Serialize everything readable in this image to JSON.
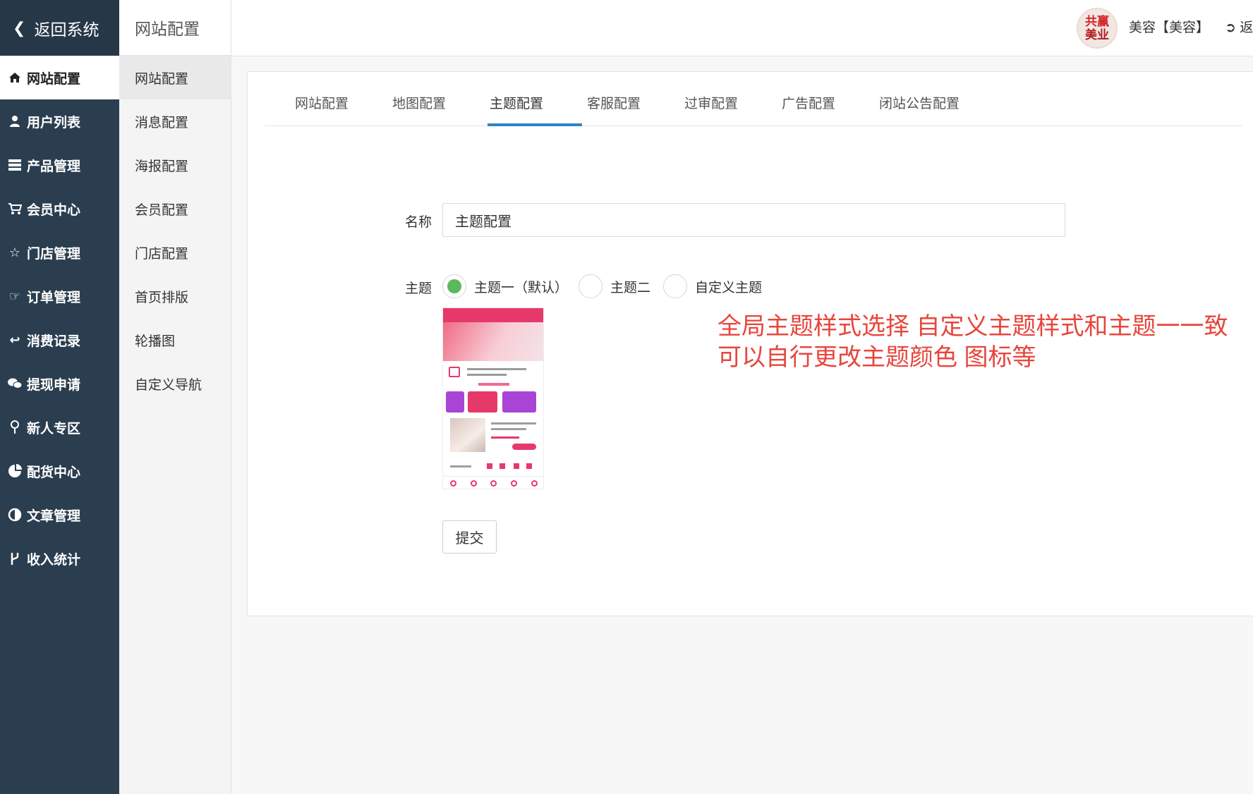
{
  "sidebar": {
    "back_label": "返回系统",
    "items": [
      {
        "label": "网站配置",
        "icon": "home-icon"
      },
      {
        "label": "用户列表",
        "icon": "user-icon"
      },
      {
        "label": "产品管理",
        "icon": "server-icon"
      },
      {
        "label": "会员中心",
        "icon": "cart-icon"
      },
      {
        "label": "门店管理",
        "icon": "star-icon"
      },
      {
        "label": "订单管理",
        "icon": "hand-right-icon"
      },
      {
        "label": "消费记录",
        "icon": "reply-icon"
      },
      {
        "label": "提现申请",
        "icon": "chat-icon"
      },
      {
        "label": "新人专区",
        "icon": "pin-icon"
      },
      {
        "label": "配货中心",
        "icon": "pie-chart-icon"
      },
      {
        "label": "文章管理",
        "icon": "contrast-icon"
      },
      {
        "label": "收入统计",
        "icon": "fork-icon"
      }
    ]
  },
  "subnav": {
    "title": "网站配置",
    "items": [
      "网站配置",
      "消息配置",
      "海报配置",
      "会员配置",
      "门店配置",
      "首页排版",
      "轮播图",
      "自定义导航"
    ]
  },
  "header": {
    "avatar_line1": "共赢",
    "avatar_line2": "美业",
    "user": "美容【美容】",
    "logout": "返"
  },
  "tabs": [
    "网站配置",
    "地图配置",
    "主题配置",
    "客服配置",
    "过审配置",
    "广告配置",
    "闭站公告配置"
  ],
  "form": {
    "name_label": "名称",
    "name_value": "主题配置",
    "theme_label": "主题",
    "theme_options": [
      "主题一（默认）",
      "主题二",
      "自定义主题"
    ],
    "selected_theme": "主题一（默认）",
    "submit_label": "提交"
  },
  "annotation": "全局主题样式选择  自定义主题样式和主题一一致 可以自行更改主题颜色 图标等",
  "colors": {
    "sidebar_bg": "#2b3e50",
    "tab_accent": "#2a85c7",
    "radio_selected": "#5cb85c",
    "annotation": "#e8453c",
    "theme_primary": "#e6396a"
  }
}
